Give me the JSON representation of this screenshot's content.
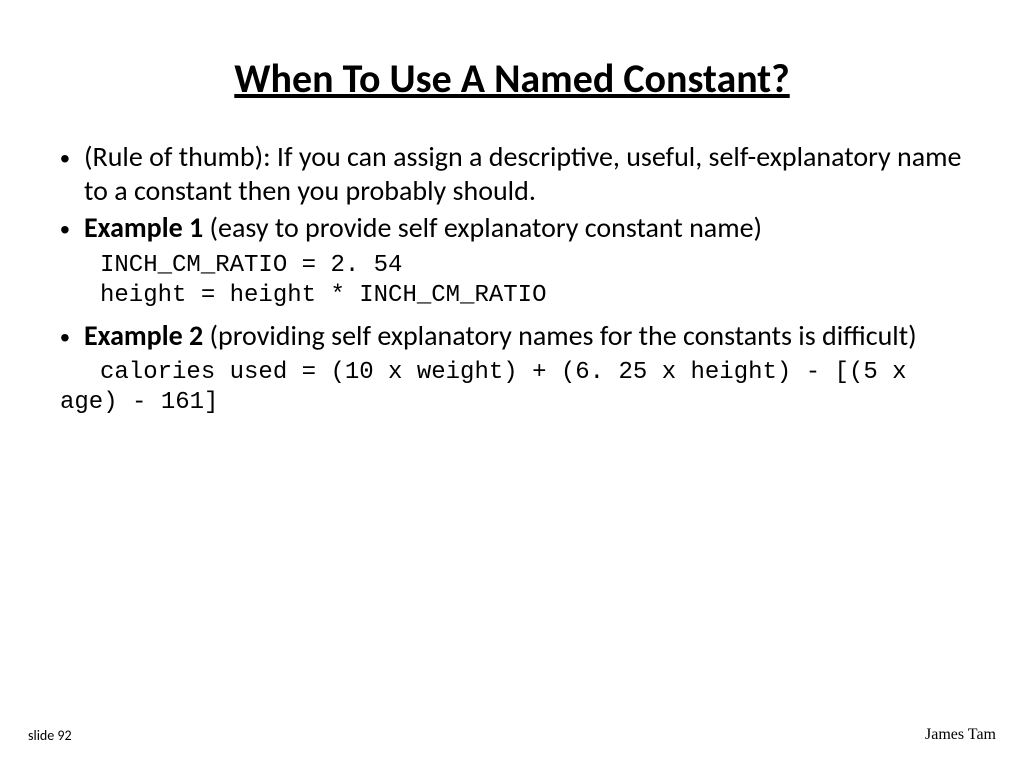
{
  "title": "When To Use A Named Constant?",
  "bullets": {
    "b1": "(Rule of thumb): If you can assign a descriptive, useful, self-explanatory name to a constant then you probably should.",
    "b2_bold": "Example 1",
    "b2_rest": " (easy to provide self explanatory constant name)",
    "code1_line1": "INCH_CM_RATIO = 2. 54",
    "code1_line2": "height = height * INCH_CM_RATIO",
    "b3_bold": "Example 2",
    "b3_rest": " (providing self explanatory names for the constants is difficult)",
    "code2": "calories used = (10 x weight) + (6. 25 x height) - [(5 x age) - 161]"
  },
  "footer": {
    "left": "slide 92",
    "right": "James Tam"
  }
}
